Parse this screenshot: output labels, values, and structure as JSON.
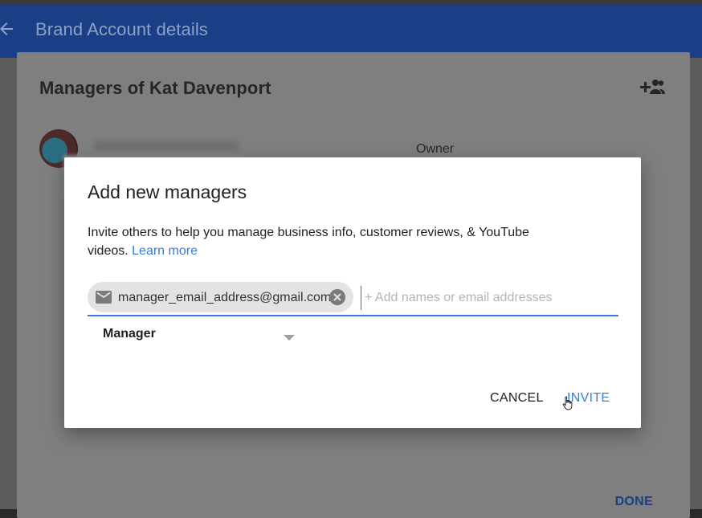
{
  "appbar": {
    "title": "Brand Account details",
    "back_icon": "arrow-left-icon"
  },
  "card": {
    "title": "Managers of Kat Davenport",
    "add_icon": "add-person-icon",
    "members": [
      {
        "role": "Owner"
      }
    ],
    "done_label": "DONE"
  },
  "dialog": {
    "title": "Add new managers",
    "description": "Invite others to help you manage business info, customer reviews, & YouTube videos.",
    "learn_more": "Learn more",
    "chip_email": "manager_email_address@gmail.com",
    "input_placeholder": "+ Add names or email addresses",
    "role_value": "Manager",
    "cancel_label": "CANCEL",
    "invite_label": "INVITE"
  },
  "colors": {
    "appbar": "#1a3f86",
    "accent": "#3b7bd6",
    "chip": "#e3e3e3"
  }
}
